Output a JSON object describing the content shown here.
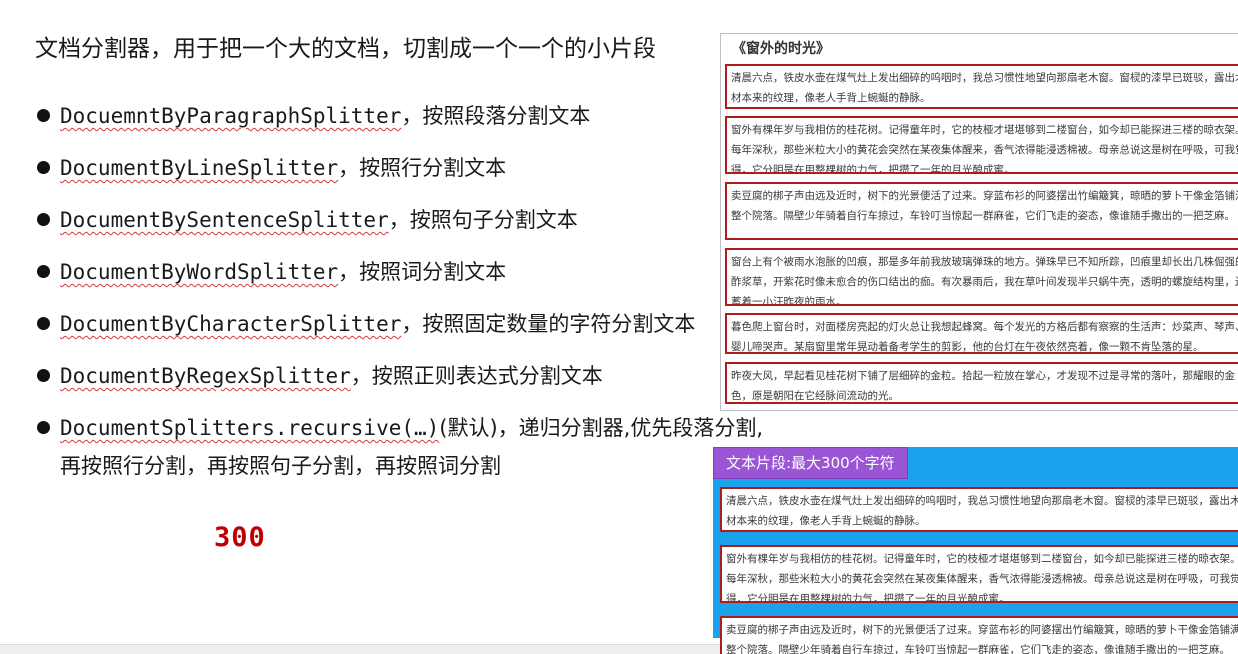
{
  "heading": "文档分割器，用于把一个大的文档，切割成一个一个的小片段",
  "bullets": [
    {
      "code": "DocuemntByParagraphSplitter",
      "text": "，按照段落分割文本"
    },
    {
      "code": "DocumentByLineSplitter",
      "text": "，按照行分割文本"
    },
    {
      "code": "DocumentBySentenceSplitter",
      "text": "，按照句子分割文本"
    },
    {
      "code": "DocumentByWordSplitter",
      "text": "，按照词分割文本"
    },
    {
      "code": "DocumentByCharacterSplitter",
      "text": "，按照固定数量的字符分割文本"
    },
    {
      "code": "DocumentByRegexSplitter",
      "text": "，按照正则表达式分割文本"
    },
    {
      "code": "DocumentSplitters.recursive(…)",
      "text": "(默认)，递归分割器,优先段落分割,",
      "continuation": "再按照行分割，再按照句子分割，再按照词分割"
    }
  ],
  "big_number": "300",
  "document": {
    "title": "《窗外的时光》",
    "paragraphs": [
      "清晨六点，铁皮水壶在煤气灶上发出细碎的呜咽时，我总习惯性地望向那扇老木窗。窗棂的漆早已斑驳，露出木材本来的纹理，像老人手背上蜿蜒的静脉。",
      "窗外有棵年岁与我相仿的桂花树。记得童年时，它的枝桠才堪堪够到二楼窗台，如今却已能探进三楼的晾衣架。每年深秋，那些米粒大小的黄花会突然在某夜集体醒来，香气浓得能浸透棉被。母亲总说这是树在呼吸，可我觉得，它分明是在用整棵树的力气，把攒了一年的月光酿成蜜。",
      "卖豆腐的梆子声由远及近时，树下的光景便活了过来。穿蓝布衫的阿婆摆出竹编簸箕，晾晒的萝卜干像金箔铺满整个院落。隔壁少年骑着自行车掠过，车铃叮当惊起一群麻雀，它们飞走的姿态，像谁随手撒出的一把芝麻。",
      "窗台上有个被雨水泡胀的凹痕，那是多年前我放玻璃弹珠的地方。弹珠早已不知所踪，凹痕里却长出几株倔强的酢浆草，开紫花时像未愈合的伤口结出的痂。有次暴雨后，我在草叶间发现半只蜗牛壳，透明的螺旋结构里，还蓄着一小汪昨夜的雨水。",
      "暮色爬上窗台时，对面楼房亮起的灯火总让我想起蜂窝。每个发光的方格后都有察察的生活声：炒菜声、琴声、婴儿啼哭声。某扇窗里常年晃动着备考学生的剪影，他的台灯在午夜依然亮着，像一颗不肯坠落的星。",
      "昨夜大风，早起看见桂花树下铺了层细碎的金粒。拾起一粒放在掌心，才发现不过是寻常的落叶，那耀眼的金色，原是朝阳在它经脉间流动的光。"
    ]
  },
  "segments": {
    "label": "文本片段:最大300个字符",
    "paragraphs": [
      "清晨六点，铁皮水壶在煤气灶上发出细碎的呜咽时，我总习惯性地望向那扇老木窗。窗棂的漆早已斑驳，露出木材本来的纹理，像老人手背上蜿蜒的静脉。",
      "窗外有棵年岁与我相仿的桂花树。记得童年时，它的枝桠才堪堪够到二楼窗台，如今却已能探进三楼的晾衣架。每年深秋，那些米粒大小的黄花会突然在某夜集体醒来，香气浓得能浸透棉被。母亲总说这是树在呼吸，可我觉得，它分明是在用整棵树的力气，把攒了一年的月光酿成蜜。",
      "卖豆腐的梆子声由远及近时，树下的光景便活了过来。穿蓝布衫的阿婆摆出竹编簸箕，晾晒的萝卜干像金箔铺满整个院落。隔壁少年骑着自行车掠过，车铃叮当惊起一群麻雀，它们飞走的姿态，像谁随手撒出的一把芝麻。"
    ]
  },
  "colors": {
    "paragraph_border": "#b01c1c",
    "segment_panel_bg": "#1aa3ec",
    "segment_label_bg": "#9a55d6",
    "big_number": "#c00000"
  }
}
